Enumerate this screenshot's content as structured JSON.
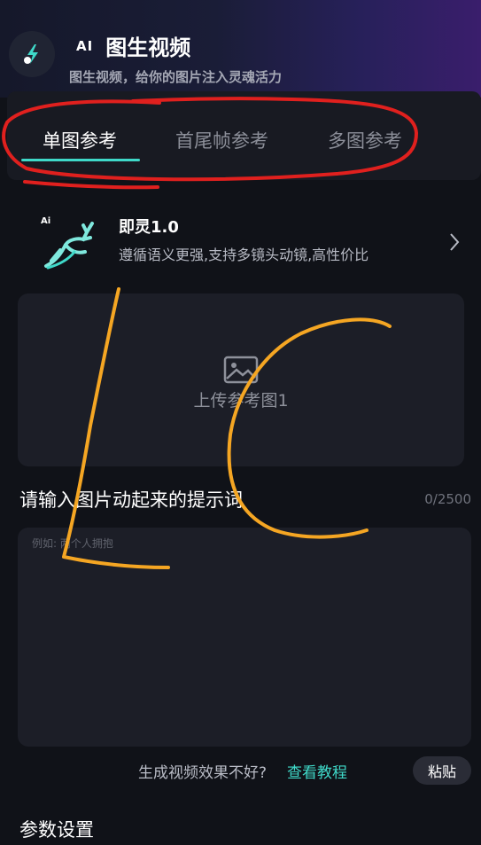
{
  "header": {
    "ai_badge": "AI",
    "title": "图生视频",
    "subtitle": "图生视频，给你的图片注入灵魂活力"
  },
  "tabs": [
    {
      "label": "单图参考",
      "active": true
    },
    {
      "label": "首尾帧参考",
      "active": false
    },
    {
      "label": "多图参考",
      "active": false
    }
  ],
  "model": {
    "icon_badge": "Ai",
    "name": "即灵1.0",
    "description": "遵循语义更强,支持多镜头动镜,高性价比"
  },
  "upload": {
    "label": "上传参考图1"
  },
  "prompt": {
    "label": "请输入图片动起来的提示词",
    "counter": "0/2500",
    "placeholder": "例如: 两个人拥抱"
  },
  "help": {
    "text": "生成视频效果不好?",
    "link": "查看教程"
  },
  "paste_label": "粘贴",
  "params_label": "参数设置",
  "colors": {
    "accent": "#3fd9c9",
    "background": "#101218",
    "card": "#1c1e27",
    "annotation_red": "#e0201e",
    "annotation_orange": "#f5a623"
  }
}
